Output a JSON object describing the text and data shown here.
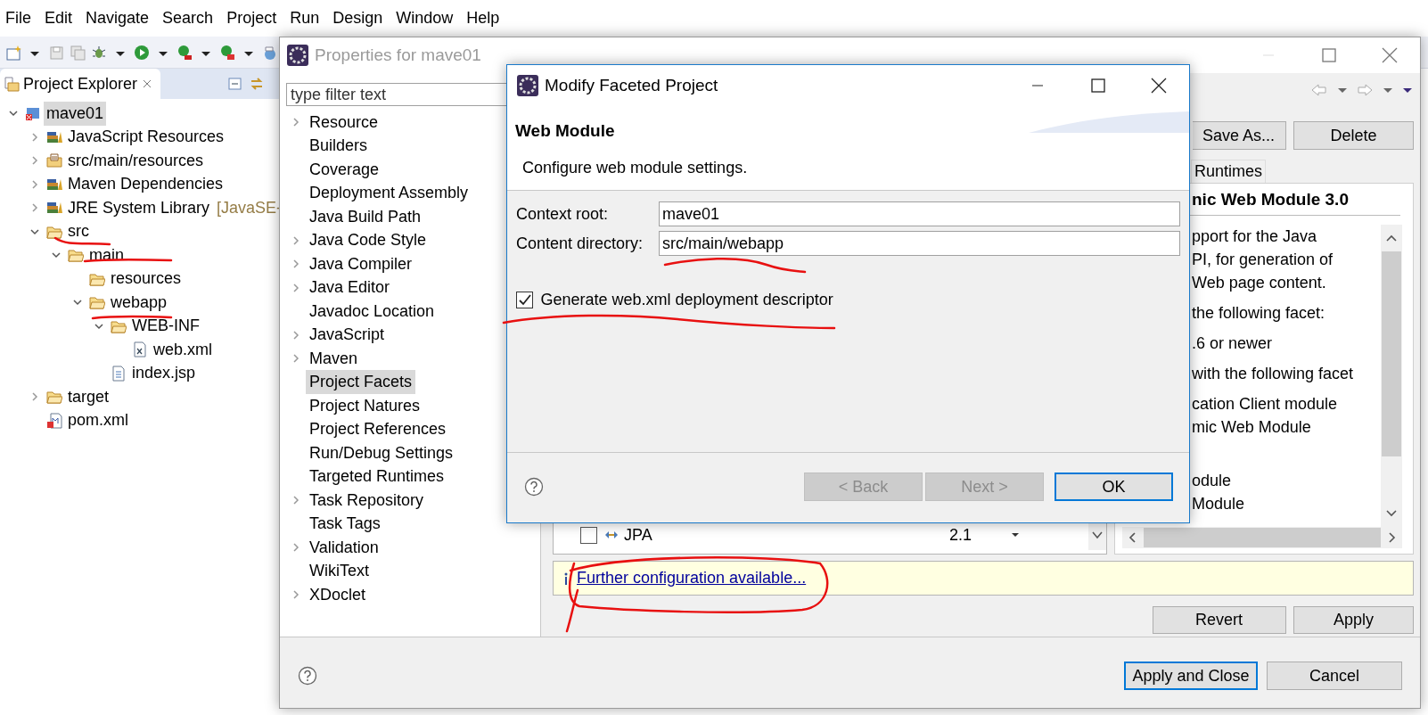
{
  "menu_bar": [
    "File",
    "Edit",
    "Navigate",
    "Search",
    "Project",
    "Run",
    "Design",
    "Window",
    "Help"
  ],
  "project_explorer": {
    "title": "Project Explorer",
    "tree": [
      {
        "label": "mave01",
        "kind": "project",
        "expanded": true,
        "selected": true,
        "children": [
          {
            "label": "JavaScript Resources",
            "kind": "library",
            "expanded": false,
            "selected": false
          },
          {
            "label": "src/main/resources",
            "kind": "package",
            "expanded": false,
            "selected": false
          },
          {
            "label": "Maven Dependencies",
            "kind": "library",
            "expanded": false,
            "selected": false
          },
          {
            "label": "JRE System Library",
            "decoration": "[JavaSE-",
            "kind": "library",
            "expanded": false,
            "selected": false
          },
          {
            "label": "src",
            "kind": "folder",
            "expanded": true,
            "selected": false,
            "children": [
              {
                "label": "main",
                "kind": "folder",
                "expanded": true,
                "selected": false,
                "children": [
                  {
                    "label": "resources",
                    "kind": "folder",
                    "selected": false
                  },
                  {
                    "label": "webapp",
                    "kind": "folder",
                    "expanded": true,
                    "selected": false,
                    "children": [
                      {
                        "label": "WEB-INF",
                        "kind": "folder",
                        "expanded": true,
                        "selected": false,
                        "children": [
                          {
                            "label": "web.xml",
                            "kind": "xml",
                            "selected": false
                          }
                        ]
                      },
                      {
                        "label": "index.jsp",
                        "kind": "file",
                        "selected": false
                      }
                    ]
                  }
                ]
              }
            ]
          },
          {
            "label": "target",
            "kind": "folder",
            "expanded": false,
            "selected": false
          },
          {
            "label": "pom.xml",
            "kind": "maven",
            "selected": false
          }
        ]
      }
    ]
  },
  "properties_window": {
    "title": "Properties for mave01",
    "filter_placeholder": "type filter text",
    "nav": [
      {
        "label": "Resource",
        "expanded": false,
        "selected": false
      },
      {
        "label": "Builders",
        "selected": false
      },
      {
        "label": "Coverage",
        "selected": false
      },
      {
        "label": "Deployment Assembly",
        "selected": false
      },
      {
        "label": "Java Build Path",
        "selected": false
      },
      {
        "label": "Java Code Style",
        "expanded": false,
        "selected": false
      },
      {
        "label": "Java Compiler",
        "expanded": false,
        "selected": false
      },
      {
        "label": "Java Editor",
        "expanded": false,
        "selected": false
      },
      {
        "label": "Javadoc Location",
        "selected": false
      },
      {
        "label": "JavaScript",
        "expanded": false,
        "selected": false
      },
      {
        "label": "Maven",
        "expanded": false,
        "selected": false
      },
      {
        "label": "Project Facets",
        "selected": true
      },
      {
        "label": "Project Natures",
        "selected": false
      },
      {
        "label": "Project References",
        "selected": false
      },
      {
        "label": "Run/Debug Settings",
        "selected": false
      },
      {
        "label": "Targeted Runtimes",
        "selected": false
      },
      {
        "label": "Task Repository",
        "expanded": false,
        "selected": false
      },
      {
        "label": "Task Tags",
        "selected": false
      },
      {
        "label": "Validation",
        "expanded": false,
        "selected": false
      },
      {
        "label": "WikiText",
        "selected": false
      },
      {
        "label": "XDoclet",
        "expanded": false,
        "selected": false
      }
    ],
    "toolbar_buttons": [
      "Save As...",
      "Delete"
    ],
    "tab": "Runtimes",
    "details": {
      "title": "nic Web Module 3.0",
      "paragraphs": [
        [
          "pport for the Java",
          "PI, for generation of",
          "Web page content."
        ],
        [
          "the following facet:"
        ],
        [
          ".6 or newer"
        ],
        [
          "with the following facet"
        ],
        [
          "cation Client module",
          "mic Web Module"
        ],
        [
          "odule",
          "Module"
        ]
      ]
    },
    "facets": [
      {
        "name": "JPA",
        "version": "2.1",
        "checked": false
      }
    ],
    "info_link": "Further configuration available...",
    "page_buttons": [
      "Revert",
      "Apply"
    ],
    "footer_buttons": [
      {
        "label": "Apply and Close",
        "default": true
      },
      {
        "label": "Cancel",
        "default": false
      }
    ]
  },
  "dialog": {
    "title": "Modify Faceted Project",
    "heading": "Web Module",
    "description": "Configure web module settings.",
    "fields": [
      {
        "label": "Context root:",
        "value": "mave01"
      },
      {
        "label": "Content directory:",
        "value": "src/main/webapp"
      }
    ],
    "checkbox": {
      "label": "Generate web.xml deployment descriptor",
      "checked": true
    },
    "buttons": [
      {
        "label": "< Back",
        "disabled": true,
        "default": false
      },
      {
        "label": "Next >",
        "disabled": true,
        "default": false
      },
      {
        "label": "OK",
        "disabled": false,
        "default": true
      }
    ]
  }
}
